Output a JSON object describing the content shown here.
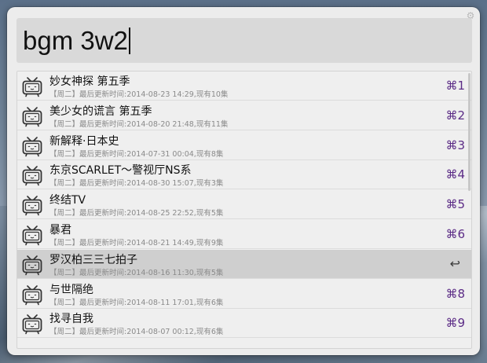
{
  "search": {
    "query": "bgm 3w2"
  },
  "results": [
    {
      "title": "妙女神探 第五季",
      "subtitle": "【周二】最后更新时间:2014-08-23 14:29,现有10集",
      "shortcut": "⌘1",
      "selected": false
    },
    {
      "title": "美少女的谎言 第五季",
      "subtitle": "【周二】最后更新时间:2014-08-20 21:48,现有11集",
      "shortcut": "⌘2",
      "selected": false
    },
    {
      "title": "新解释·日本史",
      "subtitle": "【周二】最后更新时间:2014-07-31 00:04,现有8集",
      "shortcut": "⌘3",
      "selected": false
    },
    {
      "title": "东京SCARLET～警视厅NS系",
      "subtitle": "【周二】最后更新时间:2014-08-30 15:07,现有3集",
      "shortcut": "⌘4",
      "selected": false
    },
    {
      "title": "终结TV",
      "subtitle": "【周二】最后更新时间:2014-08-25 22:52,现有5集",
      "shortcut": "⌘5",
      "selected": false
    },
    {
      "title": "暴君",
      "subtitle": "【周二】最后更新时间:2014-08-21 14:49,现有9集",
      "shortcut": "⌘6",
      "selected": false
    },
    {
      "title": "罗汉柏三三七拍子",
      "subtitle": "【周二】最后更新时间:2014-08-16 11:30,现有5集",
      "shortcut": "↩",
      "selected": true
    },
    {
      "title": "与世隔绝",
      "subtitle": "【周二】最后更新时间:2014-08-11 17:01,现有6集",
      "shortcut": "⌘8",
      "selected": false
    },
    {
      "title": "找寻自我",
      "subtitle": "【周二】最后更新时间:2014-08-07 00:12,现有6集",
      "shortcut": "⌘9",
      "selected": false
    }
  ],
  "icons": {
    "settings": "gear-icon",
    "result": "tv-icon"
  },
  "colors": {
    "shortcut": "#5b2b86",
    "selected_row": "#cfcfcf"
  }
}
